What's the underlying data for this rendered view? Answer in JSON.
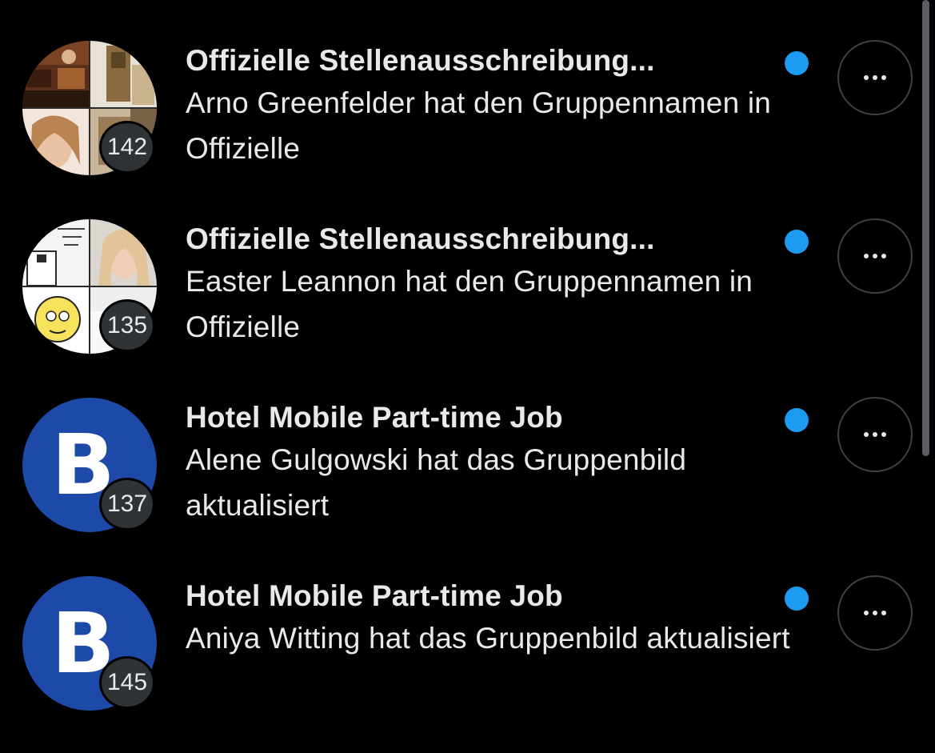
{
  "accent_color": "#1d9bf0",
  "conversations": [
    {
      "title": "Offizielle Stellenausschreibung...",
      "message": "Arno Greenfelder hat den Gruppennamen in Offizielle",
      "participant_count": "142",
      "avatar": "group-collage-avatar",
      "unread": true
    },
    {
      "title": "Offizielle Stellenausschreibung...",
      "message": "Easter Leannon hat den Gruppennamen in Offizielle",
      "participant_count": "135",
      "avatar": "group-collage-avatar",
      "unread": true
    },
    {
      "title": "Hotel Mobile Part-time Job",
      "message": "Alene Gulgowski hat das Gruppenbild aktualisiert",
      "participant_count": "137",
      "avatar": "b-logo-avatar",
      "avatar_letter": "B",
      "unread": true
    },
    {
      "title": "Hotel Mobile Part-time Job",
      "message": "Aniya Witting hat das Gruppenbild aktualisiert",
      "participant_count": "145",
      "avatar": "b-logo-avatar",
      "avatar_letter": "B",
      "unread": true
    }
  ],
  "more_button_icon": "more-horizontal-icon"
}
